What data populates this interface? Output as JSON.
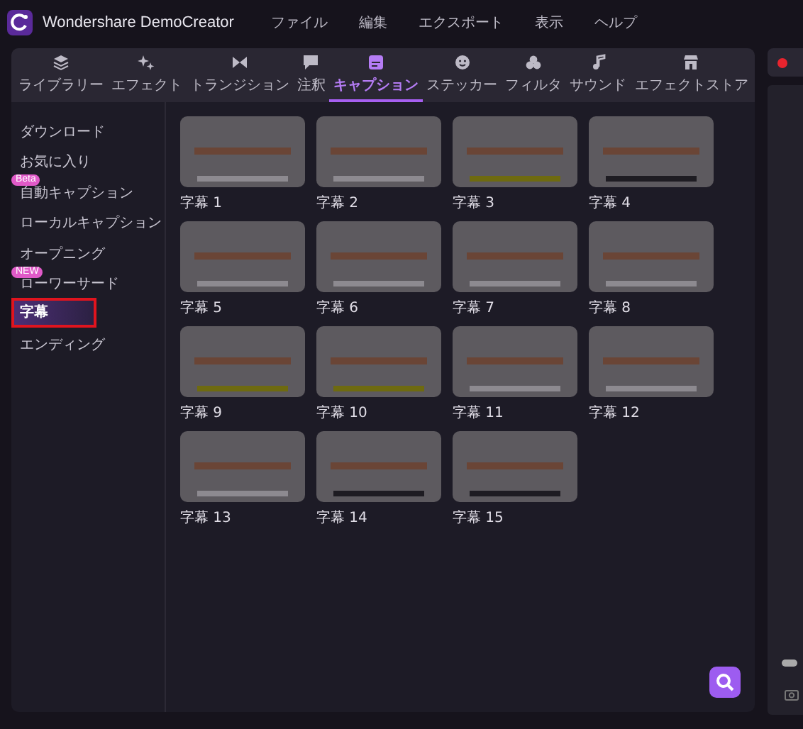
{
  "window": {
    "title": "Wondershare DemoCreator"
  },
  "menu": [
    "ファイル",
    "編集",
    "エクスポート",
    "表示",
    "ヘルプ"
  ],
  "tabs": [
    {
      "label": "ライブラリー",
      "selected": false
    },
    {
      "label": "エフェクト",
      "selected": false
    },
    {
      "label": "トランジション",
      "selected": false
    },
    {
      "label": "注釈",
      "selected": false
    },
    {
      "label": "キャプション",
      "selected": true
    },
    {
      "label": "ステッカー",
      "selected": false
    },
    {
      "label": "フィルタ",
      "selected": false
    },
    {
      "label": "サウンド",
      "selected": false
    },
    {
      "label": "エフェクトストア",
      "selected": false
    }
  ],
  "sidebar": {
    "items": [
      {
        "label": "ダウンロード",
        "selected": false,
        "highlighted": false
      },
      {
        "label": "お気に入り",
        "selected": false,
        "highlighted": false
      },
      {
        "label": "自動キャプション",
        "badge": "Beta",
        "selected": false,
        "highlighted": false
      },
      {
        "label": "ローカルキャプション",
        "selected": false,
        "highlighted": false
      },
      {
        "label": "オープニング",
        "selected": false,
        "highlighted": false
      },
      {
        "label": "ローワーサード",
        "badge": "NEW",
        "selected": false,
        "highlighted": false
      },
      {
        "label": "字幕",
        "selected": true,
        "highlighted": true
      },
      {
        "label": "エンディング",
        "selected": false,
        "highlighted": false
      }
    ]
  },
  "templates": [
    {
      "name": "字幕 1"
    },
    {
      "name": "字幕 2"
    },
    {
      "name": "字幕 3"
    },
    {
      "name": "字幕 4"
    },
    {
      "name": "字幕 5"
    },
    {
      "name": "字幕 6"
    },
    {
      "name": "字幕 7"
    },
    {
      "name": "字幕 8"
    },
    {
      "name": "字幕 9"
    },
    {
      "name": "字幕 10"
    },
    {
      "name": "字幕 11"
    },
    {
      "name": "字幕 12"
    },
    {
      "name": "字幕 13"
    },
    {
      "name": "字幕 14"
    },
    {
      "name": "字幕 15"
    }
  ]
}
